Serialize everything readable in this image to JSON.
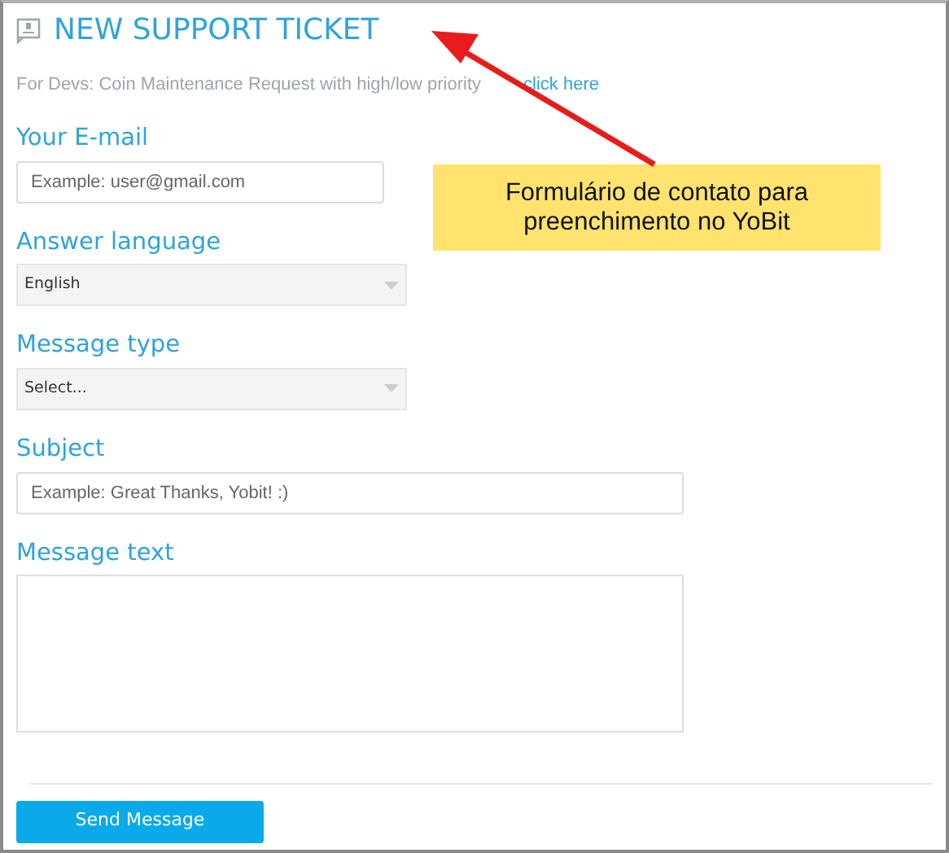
{
  "title": "NEW SUPPORT TICKET",
  "dev_note": {
    "text": "For Devs: Coin Maintenance Request with high/low priority",
    "link": "click here"
  },
  "fields": [
    {
      "kind": "email",
      "label": "Your E-mail",
      "placeholder": "Example: user@gmail.com"
    },
    {
      "kind": "select",
      "label": "Answer language",
      "value": "English"
    },
    {
      "kind": "select",
      "label": "Message type",
      "value": "Select..."
    },
    {
      "kind": "text",
      "label": "Subject",
      "placeholder": "Example: Great Thanks, Yobit! :)"
    },
    {
      "kind": "textarea",
      "label": "Message text"
    }
  ],
  "submit": "Send Message",
  "annotation": {
    "text": "Formulário de contato para preenchimento no YoBit"
  }
}
